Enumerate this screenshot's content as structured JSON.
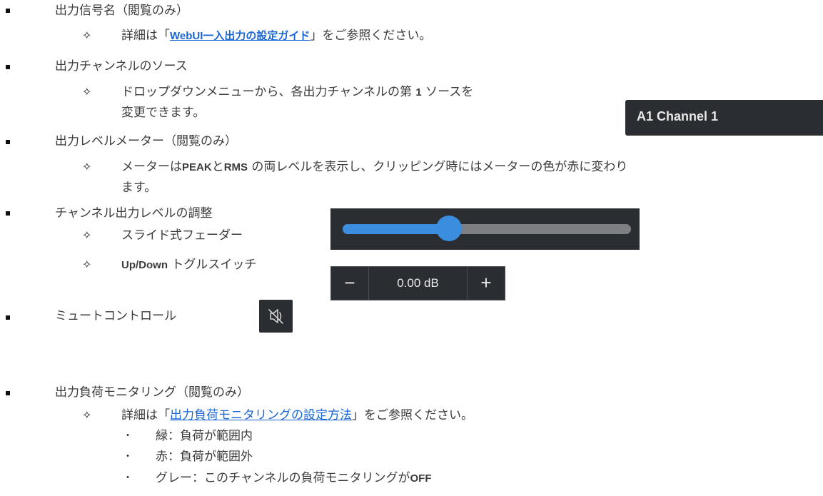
{
  "items": [
    {
      "text": "出力信号名（閲覧のみ）",
      "sub": [
        {
          "pre": "詳細は「",
          "link": "WebUI一入出力の設定ガイド",
          "post": "」をご参照ください。"
        }
      ]
    },
    {
      "text": "出力チャンネルのソース",
      "sub": [
        {
          "line1_a": "ドロップダウンメニューから、各出力チャンネルの第 ",
          "line1_num": "1",
          "line1_b": " ソースを",
          "line2": "変更できます。"
        }
      ]
    },
    {
      "text": "出力レベルメーター（閲覧のみ）",
      "sub": [
        {
          "a": "メーターは",
          "peak": "PEAK",
          "b": "と",
          "rms": "RMS",
          "c": " の両レベルを表示し、クリッピング時にはメーターの色が赤に変わり",
          "line2": "ます。"
        }
      ]
    },
    {
      "text": "チャンネル出力レベルの調整",
      "sub": [
        {
          "text": "スライド式フェーダー"
        },
        {
          "en": "Up/Down",
          "text": " トグルスイッチ"
        }
      ]
    },
    {
      "text": "ミュートコントロール"
    },
    {
      "text": "出力負荷モニタリング（閲覧のみ）",
      "sub": [
        {
          "pre": "詳細は「",
          "link": "出力負荷モニタリングの設定方法",
          "post": "」をご参照ください。"
        }
      ],
      "dots": [
        "緑：負荷が範囲内",
        "赤：負荷が範囲外",
        "グレー：このチャンネルの負荷モニタリングが"
      ],
      "off": "OFF"
    }
  ],
  "source_select": {
    "value": "A1 Channel 1"
  },
  "fader": {
    "level": 0.37
  },
  "toggle": {
    "minus": "−",
    "value": "0.00 dB",
    "plus": "+"
  },
  "mute": {
    "icon": "muted-speaker-icon"
  },
  "colors": {
    "panel": "#2a2d31",
    "accent": "#3b8de0",
    "link": "#1a66d6"
  }
}
